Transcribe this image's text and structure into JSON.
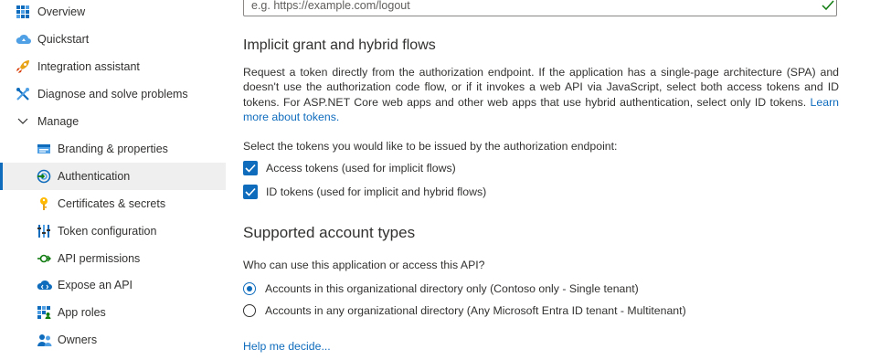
{
  "sidebar": {
    "items": [
      {
        "label": "Overview",
        "icon": "grid-icon"
      },
      {
        "label": "Quickstart",
        "icon": "cloud-icon"
      },
      {
        "label": "Integration assistant",
        "icon": "rocket-icon"
      },
      {
        "label": "Diagnose and solve problems",
        "icon": "wrench-icon"
      },
      {
        "label": "Manage",
        "icon": "chevron-down-icon"
      },
      {
        "label": "Branding & properties",
        "icon": "branding-icon"
      },
      {
        "label": "Authentication",
        "icon": "authentication-icon",
        "active": true
      },
      {
        "label": "Certificates & secrets",
        "icon": "key-icon"
      },
      {
        "label": "Token configuration",
        "icon": "token-config-icon"
      },
      {
        "label": "API permissions",
        "icon": "api-permissions-icon"
      },
      {
        "label": "Expose an API",
        "icon": "cloud-api-icon"
      },
      {
        "label": "App roles",
        "icon": "app-roles-icon"
      },
      {
        "label": "Owners",
        "icon": "owners-icon"
      }
    ]
  },
  "logout_url": {
    "placeholder": "e.g. https://example.com/logout"
  },
  "implicit": {
    "title": "Implicit grant and hybrid flows",
    "desc": "Request a token directly from the authorization endpoint. If the application has a single-page architecture (SPA) and doesn't use the authorization code flow, or if it invokes a web API via JavaScript, select both access tokens and ID tokens. For ASP.NET Core web apps and other web apps that use hybrid authentication, select only ID tokens.",
    "learn_more": "Learn more about tokens.",
    "prompt": "Select the tokens you would like to be issued by the authorization endpoint:",
    "access_tokens": {
      "label": "Access tokens (used for implicit flows)",
      "checked": true
    },
    "id_tokens": {
      "label": "ID tokens (used for implicit and hybrid flows)",
      "checked": true
    }
  },
  "account_types": {
    "title": "Supported account types",
    "prompt": "Who can use this application or access this API?",
    "options": [
      {
        "label": "Accounts in this organizational directory only (Contoso only - Single tenant)",
        "selected": true
      },
      {
        "label": "Accounts in any organizational directory (Any Microsoft Entra ID tenant - Multitenant)",
        "selected": false
      }
    ],
    "help": "Help me decide..."
  },
  "colors": {
    "accent": "#0f6cbd",
    "valid_check": "#107c10",
    "active_bg": "#efefef"
  }
}
